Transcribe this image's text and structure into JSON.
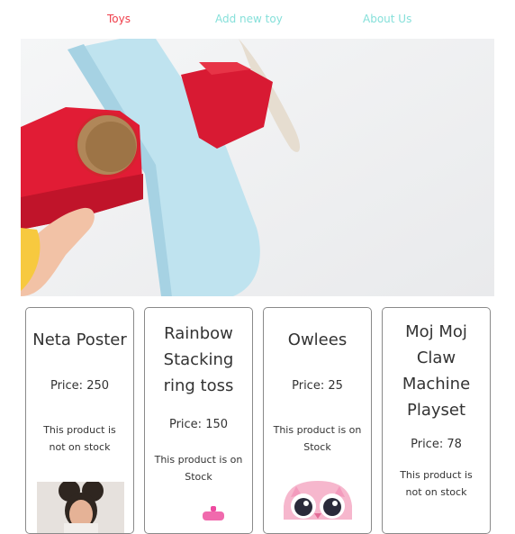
{
  "nav": {
    "toys": "Toys",
    "add_new_toy": "Add new toy",
    "about_us": "About Us"
  },
  "colors": {
    "active_link": "#ef3e4a",
    "link": "#86e0da",
    "card_border": "#8a8a8a"
  },
  "products": [
    {
      "title_lines": [
        "Neta Poster"
      ],
      "price": "Price: 250",
      "stock_lines": [
        "This product is",
        "not on stock"
      ]
    },
    {
      "title_lines": [
        "Rainbow",
        "Stacking",
        "ring toss"
      ],
      "price": "Price: 150",
      "stock_lines": [
        "This product is on",
        "Stock"
      ]
    },
    {
      "title_lines": [
        "Owlees"
      ],
      "price": "Price: 25",
      "stock_lines": [
        "This product is on",
        "Stock"
      ]
    },
    {
      "title_lines": [
        "Moj Moj",
        "Claw",
        "Machine",
        "Playset"
      ],
      "price": "Price: 78",
      "stock_lines": [
        "This product is",
        "not on stock"
      ]
    }
  ]
}
